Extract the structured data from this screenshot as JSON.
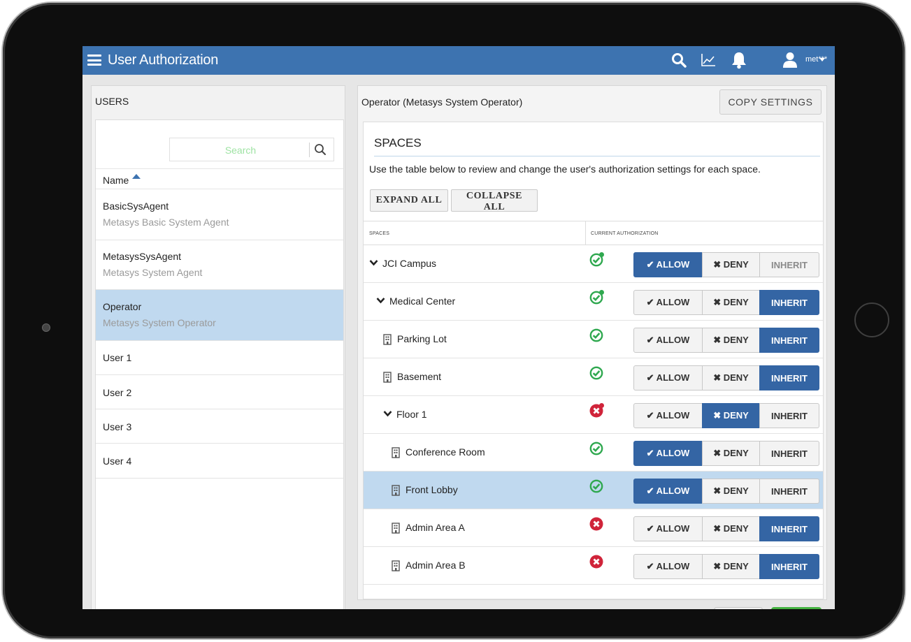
{
  "app": {
    "title": "User Authorization",
    "user_label": "met***"
  },
  "topbar_icons": [
    "search-icon",
    "chart-icon",
    "bell-icon",
    "user-icon",
    "chevron-down-icon"
  ],
  "colors": {
    "brand": "#3d73b0",
    "active_button": "#3465a4",
    "selected_row": "#c0d9ef",
    "allowed": "#2fa84f",
    "denied": "#d0243a",
    "search_placeholder": "#9fe3a4"
  },
  "users_panel": {
    "title": "USERS",
    "search_placeholder": "Search",
    "column_name": "Name",
    "users": [
      {
        "name": "BasicSysAgent",
        "description": "Metasys Basic System Agent"
      },
      {
        "name": "MetasysSysAgent",
        "description": "Metasys System Agent"
      },
      {
        "name": "Operator",
        "description": "Metasys System Operator",
        "selected": true
      },
      {
        "name": "User 1",
        "description": ""
      },
      {
        "name": "User 2",
        "description": ""
      },
      {
        "name": "User 3",
        "description": ""
      },
      {
        "name": "User 4",
        "description": ""
      }
    ]
  },
  "main": {
    "title": "Operator (Metasys System Operator)",
    "copy_settings_label": "COPY SETTINGS",
    "spaces": {
      "title": "SPACES",
      "description": "Use the table below to review and change the user's authorization settings for each space.",
      "expand_all_label": "EXPAND ALL",
      "collapse_all_label": "COLLAPSE ALL",
      "col_spaces": "SPACES",
      "col_current": "CURRENT AUTHORIZATION",
      "allow_label": "✔ ALLOW",
      "deny_label": "✖ DENY",
      "inherit_label": "INHERIT",
      "rows": [
        {
          "name": "JCI Campus",
          "kind": "group",
          "level": 0,
          "status": "allowed",
          "modified": true,
          "selection": "allow",
          "inherit_disabled": true
        },
        {
          "name": "Medical Center",
          "kind": "group",
          "level": 1,
          "status": "allowed",
          "modified": true,
          "selection": "inherit"
        },
        {
          "name": "Parking Lot",
          "kind": "building",
          "level": 1,
          "status": "allowed",
          "modified": false,
          "selection": "inherit"
        },
        {
          "name": "Basement",
          "kind": "building",
          "level": 1,
          "status": "allowed",
          "modified": false,
          "selection": "inherit"
        },
        {
          "name": "Floor 1",
          "kind": "group",
          "level": 2,
          "status": "denied",
          "modified": true,
          "selection": "deny"
        },
        {
          "name": "Conference Room",
          "kind": "building",
          "level": 2,
          "status": "allowed",
          "modified": false,
          "selection": "allow"
        },
        {
          "name": "Front Lobby",
          "kind": "building",
          "level": 2,
          "status": "allowed",
          "modified": false,
          "selection": "allow",
          "selected": true
        },
        {
          "name": "Admin Area A",
          "kind": "building",
          "level": 2,
          "status": "denied",
          "modified": false,
          "selection": "inherit"
        },
        {
          "name": "Admin Area B",
          "kind": "building",
          "level": 2,
          "status": "denied",
          "modified": false,
          "selection": "inherit"
        }
      ]
    }
  }
}
